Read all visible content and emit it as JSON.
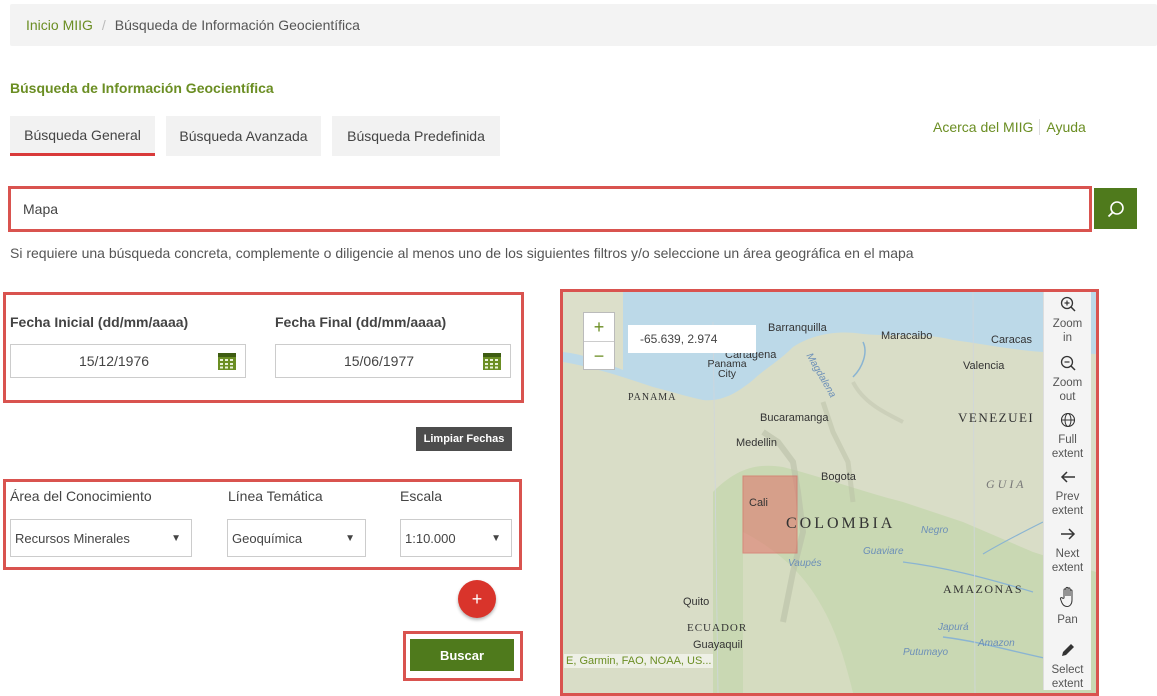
{
  "breadcrumb": {
    "home": "Inicio MIIG",
    "separator": "/",
    "current": "Búsqueda de Información Geocientífica"
  },
  "page_title": "Búsqueda de Información Geocientífica",
  "tabs": [
    {
      "label": "Búsqueda General",
      "active": true
    },
    {
      "label": "Búsqueda Avanzada",
      "active": false
    },
    {
      "label": "Búsqueda Predefinida",
      "active": false
    }
  ],
  "top_links": {
    "about": "Acerca del MIIG",
    "help": "Ayuda"
  },
  "search": {
    "value": "Mapa",
    "button_icon": "search-icon"
  },
  "hint": "Si requiere una búsqueda concreta, complemente o diligencie al menos uno de los siguientes filtros y/o seleccione un área geográfica en el mapa",
  "dates": {
    "start_label": "Fecha Inicial (dd/mm/aaaa)",
    "start_value": "15/12/1976",
    "end_label": "Fecha Final (dd/mm/aaaa)",
    "end_value": "15/06/1977",
    "clear_button": "Limpiar Fechas"
  },
  "filters": {
    "area_label": "Área del Conocimiento",
    "area_value": "Recursos Minerales",
    "linea_label": "Línea Temática",
    "linea_value": "Geoquímica",
    "escala_label": "Escala",
    "escala_value": "1:10.000"
  },
  "add_button": "+",
  "search_button": "Buscar",
  "map": {
    "zoom_in": "+",
    "zoom_out": "−",
    "coordinates": "-65.639, 2.974",
    "attribution": "E, Garmin, FAO, NOAA, US...",
    "labels": {
      "barranquilla": "Barranquilla",
      "maracaibo": "Maracaibo",
      "caracas": "Caracas",
      "cartagena": "Cartagena",
      "panama_city": "Panama City",
      "panama": "PANAMA",
      "valencia": "Valencia",
      "bucaramanga": "Bucaramanga",
      "venezuela": "VENEZUEI",
      "medellin": "Medellin",
      "bogota": "Bogota",
      "cali": "Cali",
      "colombia": "COLOMBIA",
      "guia": "G U I A",
      "amazonas": "AMAZONAS",
      "quito": "Quito",
      "ecuador": "ECUADOR",
      "guayaquil": "Guayaquil",
      "magdalena": "Magdalena",
      "negro": "Negro",
      "vaupes": "Vaupés",
      "japura": "Japurá",
      "amazon": "Amazon",
      "putumayo": "Putumayo",
      "guaviare": "Guaviare"
    },
    "tools": [
      {
        "icon": "zoom-in-icon",
        "line1": "Zoom",
        "line2": "in"
      },
      {
        "icon": "zoom-out-icon",
        "line1": "Zoom",
        "line2": "out"
      },
      {
        "icon": "globe-icon",
        "line1": "Full",
        "line2": "extent"
      },
      {
        "icon": "arrow-left-icon",
        "line1": "Prev",
        "line2": "extent"
      },
      {
        "icon": "arrow-right-icon",
        "line1": "Next",
        "line2": "extent"
      },
      {
        "icon": "hand-icon",
        "line1": "Pan",
        "line2": ""
      },
      {
        "icon": "pencil-icon",
        "line1": "Select",
        "line2": "extent"
      }
    ]
  },
  "colors": {
    "accent_green": "#6b8e23",
    "button_green": "#4f7a1c",
    "highlight_red": "#d9534f",
    "add_red": "#d9342b"
  }
}
